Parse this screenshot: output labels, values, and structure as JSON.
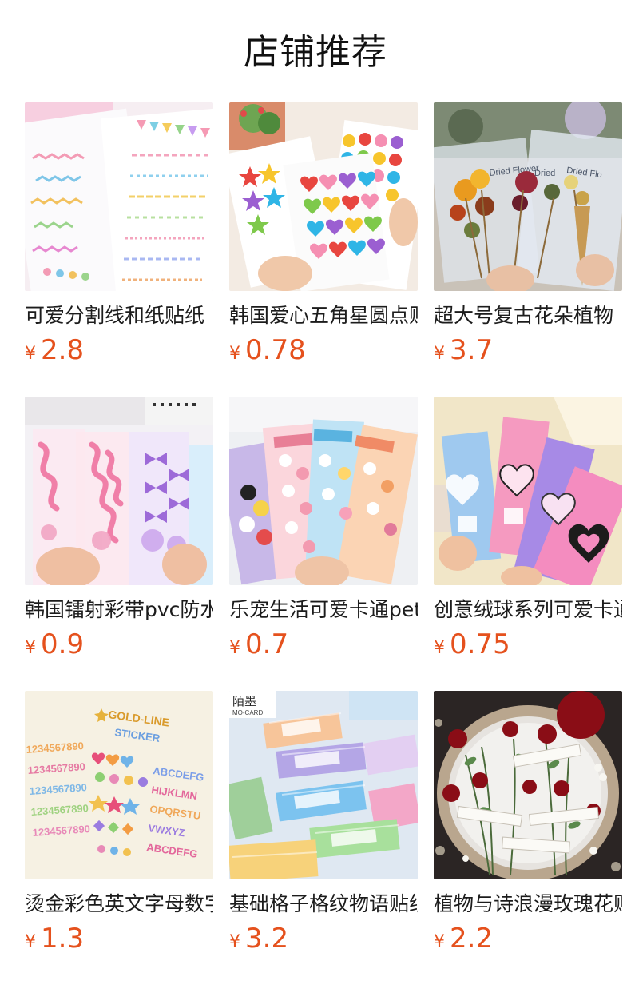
{
  "section": {
    "title": "店铺推荐"
  },
  "currency_symbol": "¥",
  "products": [
    {
      "name": "可爱分割线和纸贴纸",
      "price": "2.8"
    },
    {
      "name": "韩国爱心五角星圆点贴纸",
      "price": "0.78"
    },
    {
      "name": "超大号复古花朵植物",
      "price": "3.7"
    },
    {
      "name": "韩国镭射彩带pvc防水贴纸",
      "price": "0.9"
    },
    {
      "name": "乐宠生活可爱卡通pet贴纸",
      "price": "0.7"
    },
    {
      "name": "创意绒球系列可爱卡通贴纸",
      "price": "0.75"
    },
    {
      "name": "烫金彩色英文字母数字贴纸",
      "price": "1.3"
    },
    {
      "name": "基础格子格纹物语贴纸",
      "price": "3.2"
    },
    {
      "name": "植物与诗浪漫玫瑰花贴纸",
      "price": "2.2"
    }
  ],
  "image_lettering": {
    "product_3": [
      "Dried Flower",
      "Dried",
      "Dried Flo"
    ],
    "product_7": [
      "GOLD-LINE",
      "STICKER",
      "1234567890",
      "ABCDEFG",
      "HIJKLMN",
      "OPQRSTU",
      "VWXYZ"
    ],
    "product_8": [
      "陌墨",
      "MO-CARD"
    ]
  }
}
